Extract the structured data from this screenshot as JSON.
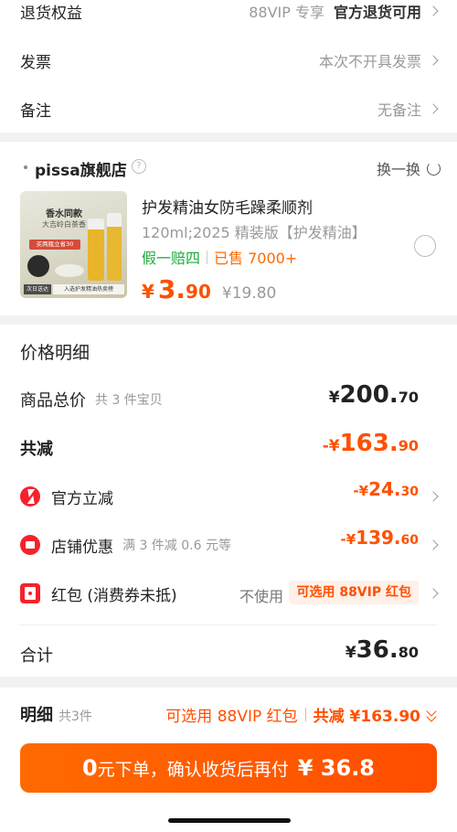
{
  "top_rows": {
    "return": {
      "label": "退货权益",
      "muted": "88VIP 专享",
      "value": "官方退货可用"
    },
    "invoice": {
      "label": "发票",
      "value": "本次不开具发票"
    },
    "remark": {
      "label": "备注",
      "value": "无备注"
    }
  },
  "shop": {
    "name": "pissa旗舰店",
    "help": "?",
    "swap_label": "换一换"
  },
  "product": {
    "image_text": {
      "headline": "香水同款",
      "subline": "大吉岭白茶香",
      "badge": "买两瓶立省30",
      "tag_left": "次日送达",
      "tag_right": "入选护发精油热卖榜"
    },
    "title": "护发精油女防毛躁柔顺剂",
    "spec": "120ml;2025 精装版【护发精油】",
    "tag_guarantee": "假一赔四",
    "tag_sold": "已售 7000+",
    "price_symbol": "¥",
    "price_int": "3.",
    "price_dec": "90",
    "orig_price": "¥19.80"
  },
  "price_detail": {
    "title": "价格明细",
    "goods_total": {
      "label": "商品总价",
      "sub": "共 3 件宝贝",
      "sym": "¥",
      "int": "200.",
      "dec": "70"
    },
    "reduction": {
      "label": "共减",
      "sym": "-¥",
      "int": "163.",
      "dec": "90"
    },
    "official": {
      "label": "官方立减",
      "sym": "-¥",
      "int": "24.",
      "dec": "30"
    },
    "store": {
      "label": "店铺优惠",
      "sub": "满 3 件减 0.6 元等",
      "sym": "-¥",
      "int": "139.",
      "dec": "60"
    },
    "redpack": {
      "label": "红包 (消费券未抵)",
      "unused": "不使用",
      "pill": "可选用 88VIP 红包"
    },
    "total": {
      "label": "合计",
      "sym": "¥",
      "int": "36.",
      "dec": "80"
    }
  },
  "bottom_bar": {
    "detail_label": "明细",
    "detail_count": "共3件",
    "redpack_hint": "可选用 88VIP 红包",
    "reduce_label": "共减 ¥163.90",
    "cta_prefix": "0",
    "cta_text": "元下单，确认收货后再付 ",
    "cta_amount": "¥ 36.8"
  },
  "colors": {
    "accent": "#ff5000",
    "green": "#1aad3c",
    "bg": "#f2f2f4"
  }
}
